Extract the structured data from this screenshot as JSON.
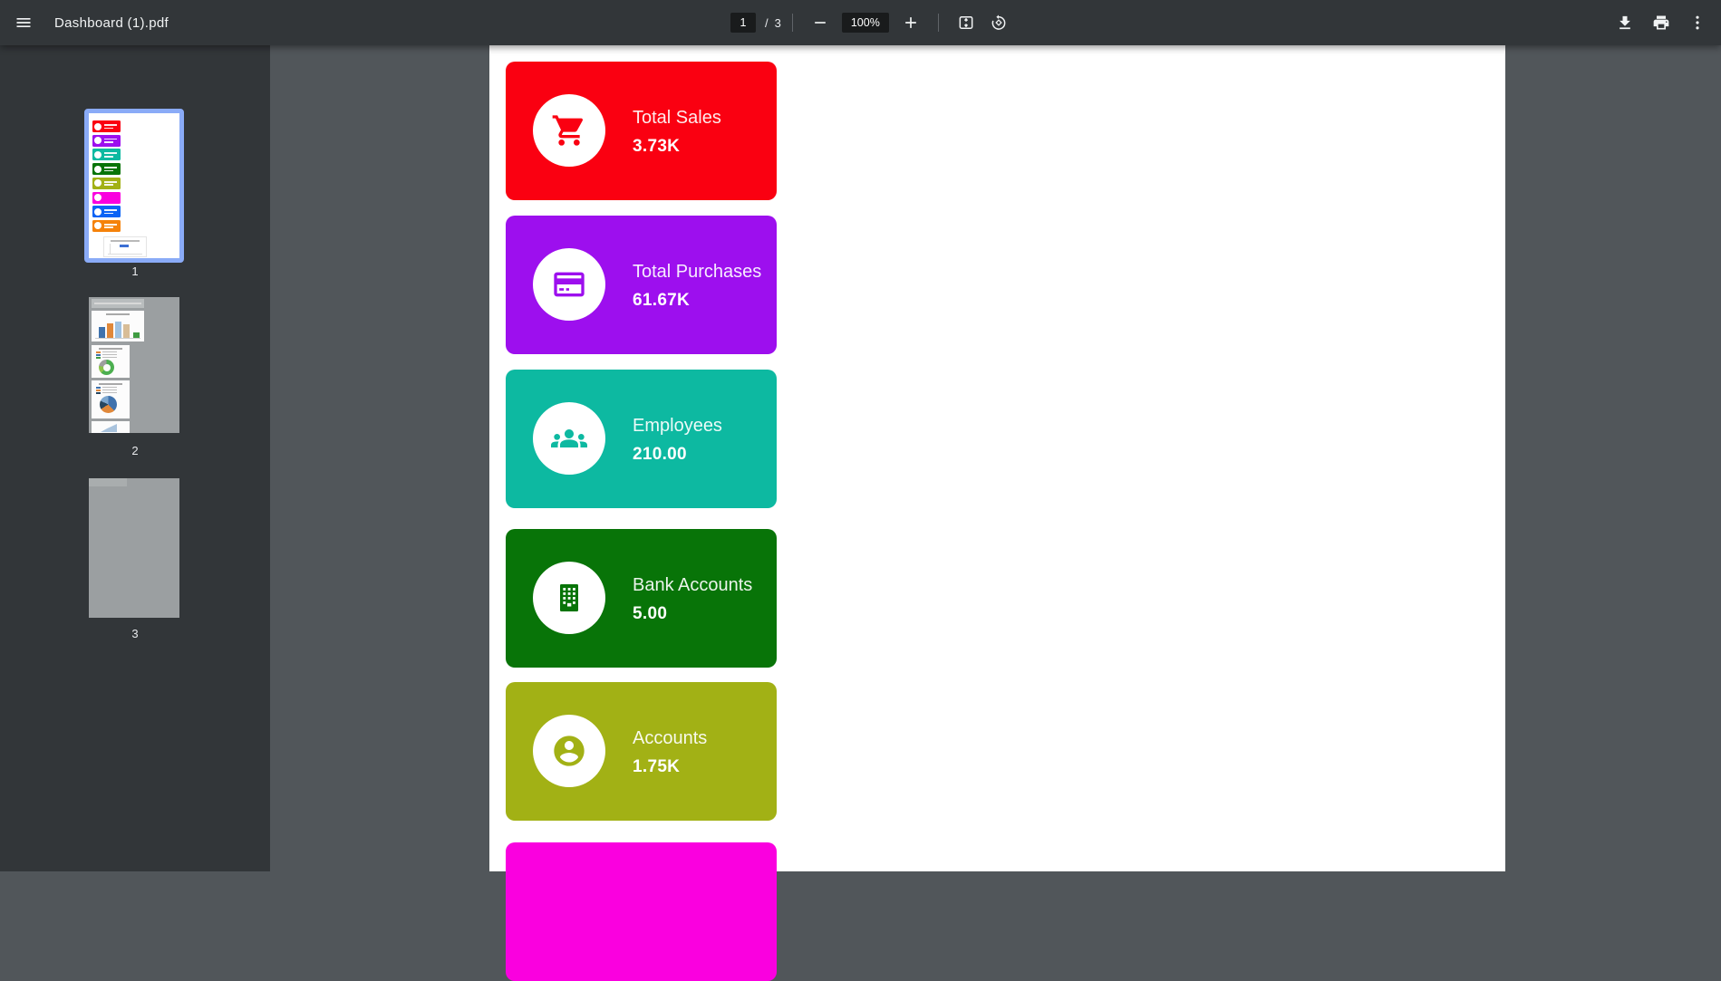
{
  "toolbar": {
    "title": "Dashboard (1).pdf",
    "page_input": "1",
    "page_divider": "/",
    "page_count": "3",
    "zoom_value": "100%",
    "icons": [
      "menu-icon",
      "zoom-out-icon",
      "zoom-in-icon",
      "fit-to-page-icon",
      "rotate-ccw-icon",
      "download-icon",
      "print-icon",
      "more-vert-icon"
    ]
  },
  "sidebar": {
    "thumbnails": [
      {
        "label": "1",
        "selected": true
      },
      {
        "label": "2",
        "selected": false
      },
      {
        "label": "3",
        "selected": false
      }
    ],
    "page1_strip_colors": [
      "#fa0011",
      "#9d0fee",
      "#0db9a1",
      "#087408",
      "#a2b115",
      "#fa00df",
      "#0b63f5",
      "#f5820a"
    ]
  },
  "document": {
    "cards": [
      {
        "title": "Total Sales",
        "value": "3.73K",
        "color": "#fa0011",
        "icon": "cart-icon"
      },
      {
        "title": "Total Purchases",
        "value": "61.67K",
        "color": "#9d0fee",
        "icon": "credit-card-icon"
      },
      {
        "title": "Employees",
        "value": "210.00",
        "color": "#0db9a1",
        "icon": "people-icon"
      },
      {
        "title": "Bank Accounts",
        "value": "5.00",
        "color": "#087408",
        "icon": "building-icon"
      },
      {
        "title": "Accounts",
        "value": "1.75K",
        "color": "#a2b115",
        "icon": "person-circle-icon"
      },
      {
        "title": "",
        "value": "",
        "color": "#fa00df",
        "icon": ""
      }
    ]
  },
  "colors": {
    "toolbar_bg": "#323639",
    "sidebar_bg": "#323639",
    "viewer_bg": "#51565a",
    "page_bg": "#ffffff",
    "input_bg": "#191b1c",
    "selection_blue": "#8aabf7",
    "icon_color": "#f1f3f4"
  }
}
